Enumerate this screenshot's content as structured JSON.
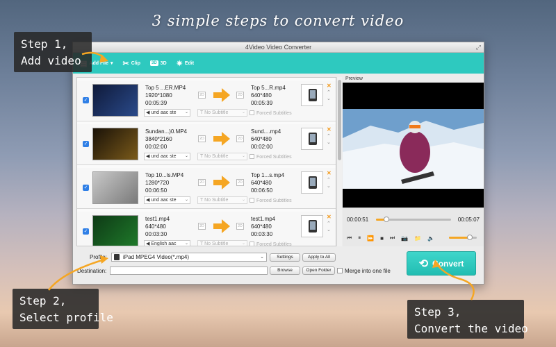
{
  "headline": "3 simple steps to convert video",
  "callouts": {
    "step1": [
      "Step 1,",
      "Add video"
    ],
    "step2": [
      "Step 2,",
      "Select profile"
    ],
    "step3": [
      "Step 3,",
      "Convert the video"
    ]
  },
  "window": {
    "title": "4Video Video Converter"
  },
  "toolbar": {
    "add_file": "Add File",
    "clip": "Clip",
    "threed_badge": "3D",
    "threed": "3D",
    "edit": "Edit"
  },
  "files": [
    {
      "in_name": "Top 5 ...ER.MP4",
      "in_res": "1920*1080",
      "in_dur": "00:05:39",
      "out_name": "Top 5...R.mp4",
      "out_res": "640*480",
      "out_dur": "00:05:39",
      "audio": "und aac ste",
      "subtitle": "No Subtitle",
      "forced": "Forced Subtitles",
      "thumb_colors": [
        "#0f1a3a",
        "#2a4a8a"
      ]
    },
    {
      "in_name": "Sundan...)0.MP4",
      "in_res": "3840*2160",
      "in_dur": "00:02:00",
      "out_name": "Sund....mp4",
      "out_res": "640*480",
      "out_dur": "00:02:00",
      "audio": "und aac ste",
      "subtitle": "No Subtitle",
      "forced": "Forced Subtitles",
      "thumb_colors": [
        "#1a1208",
        "#7a5a1a"
      ]
    },
    {
      "in_name": "Top 10...ls.MP4",
      "in_res": "1280*720",
      "in_dur": "00:06:50",
      "out_name": "Top 1...s.mp4",
      "out_res": "640*480",
      "out_dur": "00:06:50",
      "audio": "und aac ste",
      "subtitle": "No Subtitle",
      "forced": "Forced Subtitles",
      "thumb_colors": [
        "#c8c8c8",
        "#7a7a7a"
      ]
    },
    {
      "in_name": "test1.mp4",
      "in_res": "640*480",
      "in_dur": "00:03:30",
      "out_name": "test1.mp4",
      "out_res": "640*480",
      "out_dur": "00:03:30",
      "audio": "English aac",
      "subtitle": "No Subtitle",
      "forced": "Forced Subtitles",
      "thumb_colors": [
        "#0e3a16",
        "#1f7a2a"
      ]
    }
  ],
  "badge_2d": "2D",
  "preview": {
    "label": "Preview",
    "current_time": "00:00:51",
    "total_time": "00:05:07",
    "progress": 0.14,
    "volume": 0.75
  },
  "bottom": {
    "profile_label": "Profile:",
    "profile_value": "iPad MPEG4 Video(*.mp4)",
    "settings": "Settings",
    "apply_all": "Apply to All",
    "destination_label": "Destination:",
    "destination_value": "",
    "browse": "Browse",
    "open_folder": "Open Folder",
    "merge": "Merge into one file",
    "convert": "Convert"
  },
  "colors": {
    "accent": "#2ec9bf",
    "arrow": "#f5a623",
    "checkbox": "#2f7fe6"
  }
}
